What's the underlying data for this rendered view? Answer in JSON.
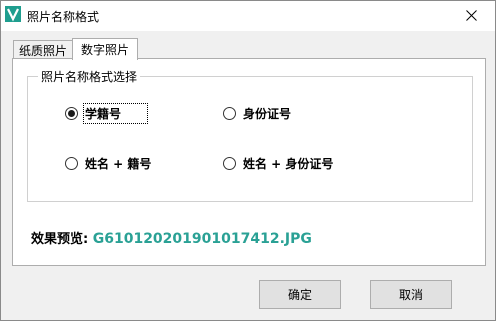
{
  "window": {
    "title": "照片名称格式",
    "close_glyph": "✕",
    "icon_letter": "V"
  },
  "tabs": [
    {
      "label": "纸质照片",
      "active": false
    },
    {
      "label": "数字照片",
      "active": true
    }
  ],
  "group": {
    "legend": "照片名称格式选择",
    "options": [
      {
        "label": "学籍号",
        "checked": true
      },
      {
        "label": "身份证号",
        "checked": false
      },
      {
        "label": "姓名 + 籍号",
        "checked": false
      },
      {
        "label": "姓名 + 身份证号",
        "checked": false
      }
    ]
  },
  "preview": {
    "label": "效果预览:",
    "value": "G610120201901017412.JPG",
    "value_color": "#2aa195"
  },
  "buttons": {
    "ok": "确定",
    "cancel": "取消"
  },
  "colors": {
    "app_icon": "#1f9e8f"
  }
}
